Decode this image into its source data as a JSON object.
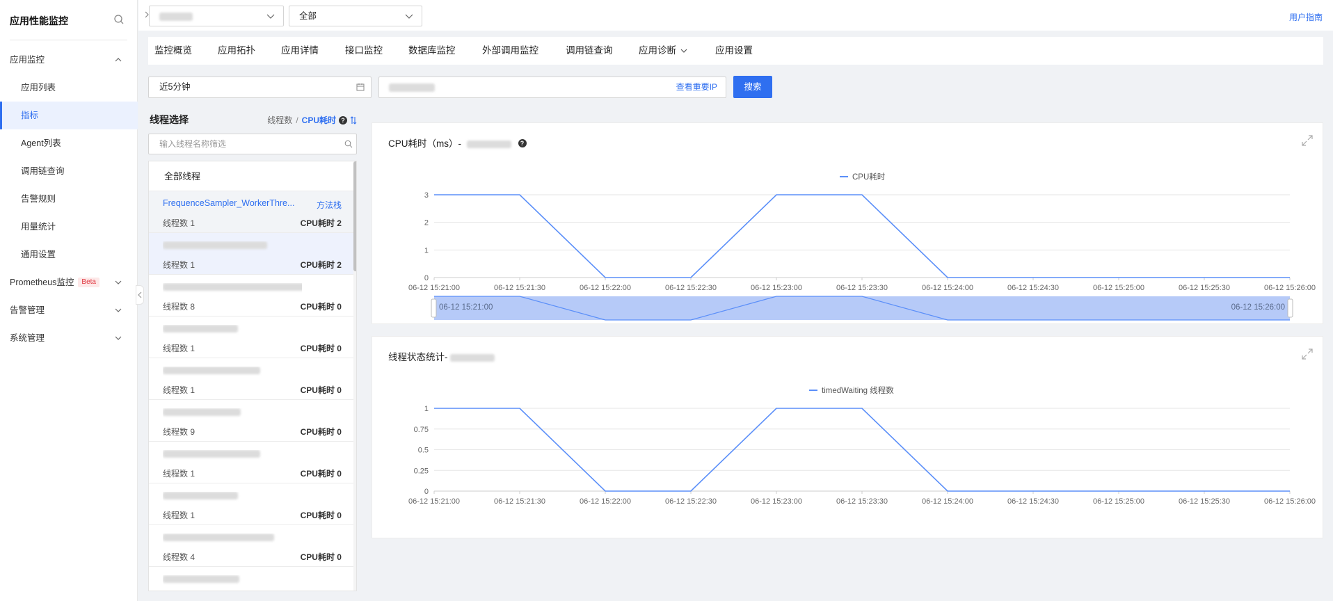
{
  "sidebar": {
    "title": "应用性能监控",
    "items": [
      {
        "label": "应用监控",
        "level": 1,
        "expanded": true
      },
      {
        "label": "应用列表",
        "level": 2
      },
      {
        "label": "指标",
        "level": 2,
        "active": true
      },
      {
        "label": "Agent列表",
        "level": 2
      },
      {
        "label": "调用链查询",
        "level": 2
      },
      {
        "label": "告警规则",
        "level": 2
      },
      {
        "label": "用量统计",
        "level": 2
      },
      {
        "label": "通用设置",
        "level": 2
      },
      {
        "label": "Prometheus监控",
        "level": 1,
        "badge": "Beta"
      },
      {
        "label": "告警管理",
        "level": 1
      },
      {
        "label": "系统管理",
        "level": 1
      }
    ]
  },
  "topbar": {
    "select2_value": "全部",
    "user_guide": "用户指南"
  },
  "tabs": [
    {
      "label": "监控概览"
    },
    {
      "label": "应用拓扑"
    },
    {
      "label": "应用详情"
    },
    {
      "label": "接口监控"
    },
    {
      "label": "数据库监控"
    },
    {
      "label": "外部调用监控"
    },
    {
      "label": "调用链查询"
    },
    {
      "label": "应用诊断",
      "dropdown": true
    },
    {
      "label": "应用设置"
    }
  ],
  "filters": {
    "time_range": "近5分钟",
    "ip_link": "查看重要IP",
    "search_button": "搜索"
  },
  "threads": {
    "title": "线程选择",
    "sort_by_count": "线程数",
    "sort_separator": "/",
    "sort_by_cpu": "CPU耗时",
    "filter_placeholder": "输入线程名称筛选",
    "all_label": "全部线程",
    "method_link": "方法栈",
    "items": [
      {
        "name": "FrequenceSampler_WorkerThre...",
        "count": "线程数 1",
        "cpu": "CPU耗时 2"
      },
      {
        "name": "",
        "count": "线程数 1",
        "cpu": "CPU耗时 2"
      },
      {
        "name": "",
        "count": "线程数 8",
        "cpu": "CPU耗时 0"
      },
      {
        "name": "",
        "count": "线程数 1",
        "cpu": "CPU耗时 0"
      },
      {
        "name": "",
        "count": "线程数 1",
        "cpu": "CPU耗时 0"
      },
      {
        "name": "",
        "count": "线程数 9",
        "cpu": "CPU耗时 0"
      },
      {
        "name": "",
        "count": "线程数 1",
        "cpu": "CPU耗时 0"
      },
      {
        "name": "",
        "count": "线程数 1",
        "cpu": "CPU耗时 0"
      },
      {
        "name": "",
        "count": "线程数 4",
        "cpu": "CPU耗时 0"
      }
    ]
  },
  "colors": {
    "accent": "#2f6ff0",
    "line": "#5b8ff9",
    "slider_fill": "#a9c1f7"
  },
  "chart_data": [
    {
      "type": "line",
      "title": "CPU耗时（ms）-",
      "legend": [
        "CPU耗时"
      ],
      "x": [
        "06-12 15:21:00",
        "06-12 15:21:30",
        "06-12 15:22:00",
        "06-12 15:22:30",
        "06-12 15:23:00",
        "06-12 15:23:30",
        "06-12 15:24:00",
        "06-12 15:24:30",
        "06-12 15:25:00",
        "06-12 15:25:30",
        "06-12 15:26:00"
      ],
      "series": [
        {
          "name": "CPU耗时",
          "values": [
            3,
            3,
            0,
            0,
            3,
            3,
            0,
            0,
            0,
            0,
            0
          ]
        }
      ],
      "yticks": [
        "0",
        "1",
        "2",
        "3"
      ],
      "ylim": [
        0,
        3
      ],
      "slider": {
        "start": "06-12 15:21:00",
        "end": "06-12 15:26:00"
      }
    },
    {
      "type": "line",
      "title": "线程状态统计-",
      "legend": [
        "timedWaiting 线程数"
      ],
      "x": [
        "06-12 15:21:00",
        "06-12 15:21:30",
        "06-12 15:22:00",
        "06-12 15:22:30",
        "06-12 15:23:00",
        "06-12 15:23:30",
        "06-12 15:24:00",
        "06-12 15:24:30",
        "06-12 15:25:00",
        "06-12 15:25:30",
        "06-12 15:26:00"
      ],
      "series": [
        {
          "name": "timedWaiting 线程数",
          "values": [
            1,
            1,
            0,
            0,
            1,
            1,
            0,
            0,
            0,
            0,
            0
          ]
        }
      ],
      "yticks": [
        "0",
        "0.25",
        "0.5",
        "0.75",
        "1"
      ],
      "ylim": [
        0,
        1
      ]
    }
  ]
}
